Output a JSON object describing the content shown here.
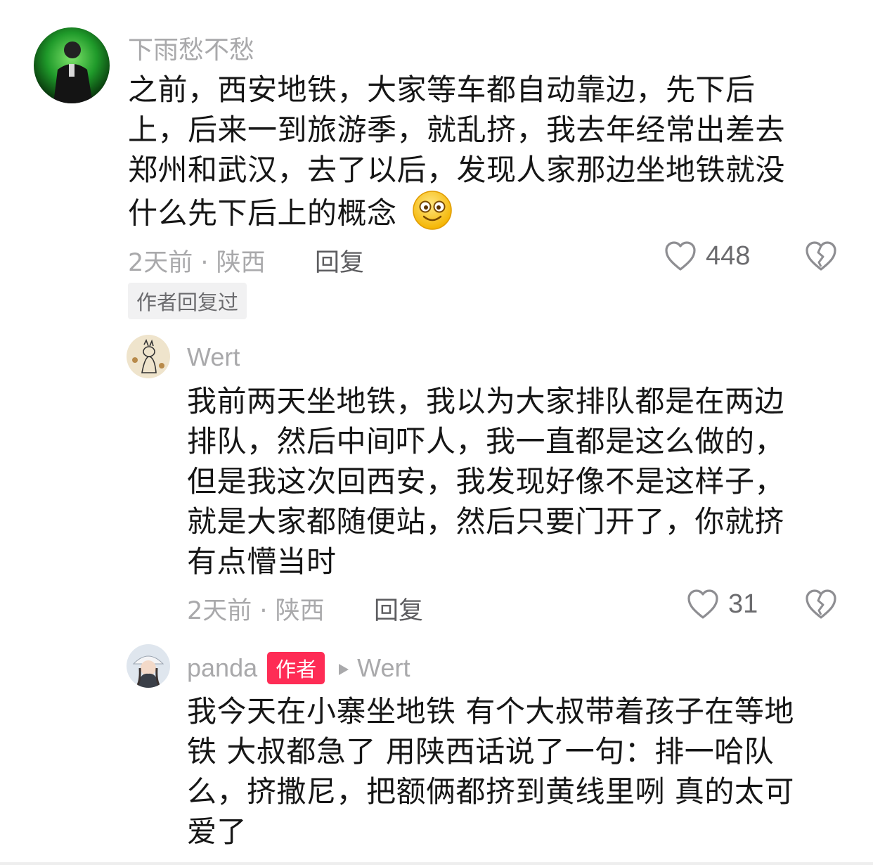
{
  "comments": [
    {
      "username": "下雨愁不愁",
      "lines": [
        "之前，西安地铁，大家等车都自动靠边，先下后",
        "上，后来一到旅游季，就乱挤，我去年经常出差去",
        "郑州和武汉，去了以后，发现人家那边坐地铁就没",
        "什么先下后上的概念"
      ],
      "emoji": "smile-emoji",
      "time": "2天前 · 陕西",
      "reply_label": "回复",
      "likes": "448",
      "tag": "作者回复过"
    },
    {
      "username": "Wert",
      "lines": [
        "我前两天坐地铁，我以为大家排队都是在两边",
        "排队，然后中间吓人，我一直都是这么做的，",
        "但是我这次回西安，我发现好像不是这样子，",
        "就是大家都随便站，然后只要门开了，你就挤",
        "有点懵当时"
      ],
      "time": "2天前 · 陕西",
      "reply_label": "回复",
      "likes": "31"
    },
    {
      "username": "panda",
      "badge": "作者",
      "reply_to": "Wert",
      "lines": [
        "我今天在小寨坐地铁 有个大叔带着孩子在等地",
        "铁 大叔都急了 用陕西话说了一句：排一哈队",
        "么，挤撒尼，把额俩都挤到黄线里咧 真的太可",
        "爱了"
      ]
    }
  ],
  "colors": {
    "text": "#161616",
    "meta": "#a9a9ab",
    "badge": "#fe2c55"
  }
}
